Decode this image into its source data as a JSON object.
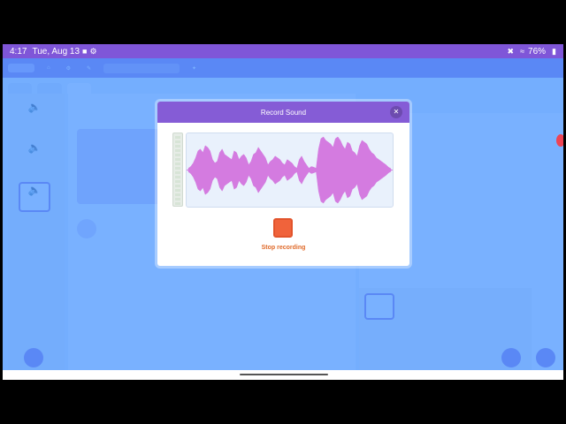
{
  "status_bar": {
    "time": "4:17",
    "date": "Tue, Aug 13",
    "battery": "76%",
    "icons": [
      "video-icon",
      "gear-icon",
      "mute-icon",
      "wifi-icon",
      "battery-icon"
    ]
  },
  "colors": {
    "accent": "#855cd6",
    "overlay": "#4c97ff",
    "stop": "#f0633b",
    "waveform": "#d47be0"
  },
  "modal": {
    "title": "Record Sound",
    "close_icon": "close-icon",
    "stop_label": "Stop recording"
  },
  "waveform": {
    "amplitudes": [
      0.05,
      0.1,
      0.2,
      0.35,
      0.55,
      0.6,
      0.5,
      0.7,
      0.65,
      0.55,
      0.3,
      0.2,
      0.25,
      0.5,
      0.6,
      0.45,
      0.4,
      0.35,
      0.3,
      0.55,
      0.5,
      0.3,
      0.4,
      0.45,
      0.35,
      0.15,
      0.25,
      0.45,
      0.5,
      0.65,
      0.55,
      0.45,
      0.35,
      0.15,
      0.25,
      0.3,
      0.4,
      0.35,
      0.3,
      0.2,
      0.15,
      0.3,
      0.25,
      0.2,
      0.1,
      0.05,
      0.3,
      0.4,
      0.25,
      0.15,
      0.05,
      0.1,
      0.08,
      0.05,
      0.6,
      0.9,
      0.95,
      0.85,
      0.8,
      0.75,
      0.65,
      0.9,
      0.95,
      0.85,
      0.7,
      0.6,
      0.8,
      0.75,
      0.55,
      0.5,
      0.4,
      0.7,
      0.85,
      0.8,
      0.75,
      0.6,
      0.5,
      0.45,
      0.35,
      0.3,
      0.25,
      0.2,
      0.15,
      0.08,
      0.04
    ]
  }
}
